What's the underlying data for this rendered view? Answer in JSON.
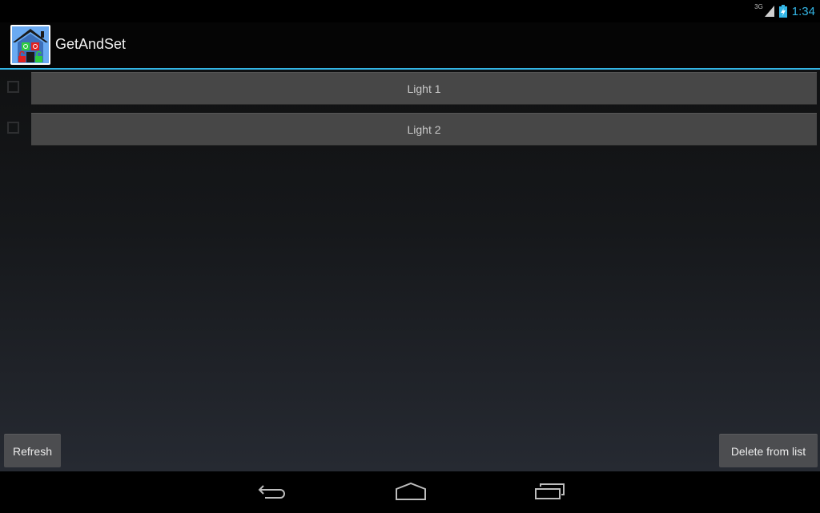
{
  "status_bar": {
    "network_type": "3G",
    "signal_icon": "signal-strength-icon",
    "battery_icon": "battery-charging-icon",
    "time": "1:34",
    "accent_color": "#33b5e5"
  },
  "action_bar": {
    "app_icon": "house-app-icon",
    "title": "GetAndSet"
  },
  "list": {
    "items": [
      {
        "label": "Light 1",
        "checked": false
      },
      {
        "label": "Light 2",
        "checked": false
      }
    ]
  },
  "footer": {
    "refresh_label": "Refresh",
    "delete_label": "Delete from list"
  },
  "nav_bar": {
    "back_icon": "back-icon",
    "home_icon": "home-icon",
    "recents_icon": "recent-apps-icon"
  }
}
